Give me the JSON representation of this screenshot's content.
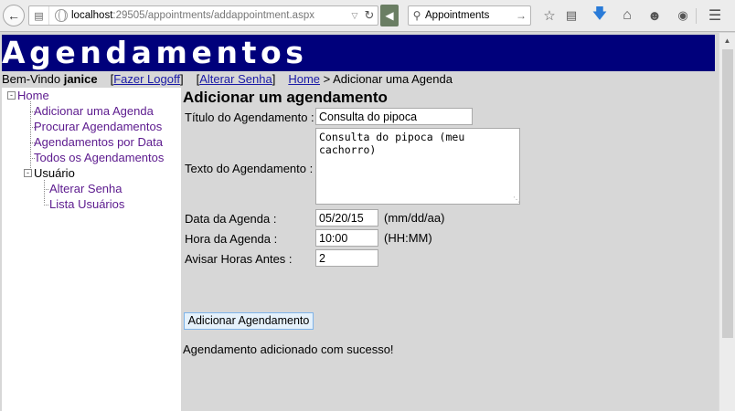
{
  "browser": {
    "url_host": "localhost",
    "url_path": ":29505/appointments/addappointment.aspx",
    "search_value": "Appointments"
  },
  "site": {
    "banner_title": "Agendamentos",
    "welcome_text": "Bem-Vindo",
    "username": "janice",
    "logout_link": "Fazer Logoff",
    "change_password_link": "Alterar Senha",
    "breadcrumb_home": "Home",
    "breadcrumb_sep": ">",
    "breadcrumb_current": "Adicionar uma Agenda"
  },
  "nav": {
    "root": "Home",
    "items": [
      "Adicionar uma Agenda",
      "Procurar Agendamentos",
      "Agendamentos por Data",
      "Todos os Agendamentos"
    ],
    "user_group": "Usuário",
    "user_items": [
      "Alterar Senha",
      "Lista Usuários"
    ]
  },
  "form": {
    "heading": "Adicionar um agendamento",
    "title_label": "Título do Agendamento :",
    "title_value": "Consulta do pipoca",
    "text_label": "Texto do Agendamento :",
    "text_value": "Consulta do pipoca (meu\ncachorro)",
    "date_label": "Data da Agenda :",
    "date_value": "05/20/15",
    "date_hint": "(mm/dd/aa)",
    "time_label": "Hora da Agenda :",
    "time_value": "10:00",
    "time_hint": "(HH:MM)",
    "notify_label": "Avisar Horas Antes :",
    "notify_value": "2",
    "submit_label": "Adicionar Agendamento",
    "success_message": "Agendamento adicionado com sucesso!"
  }
}
